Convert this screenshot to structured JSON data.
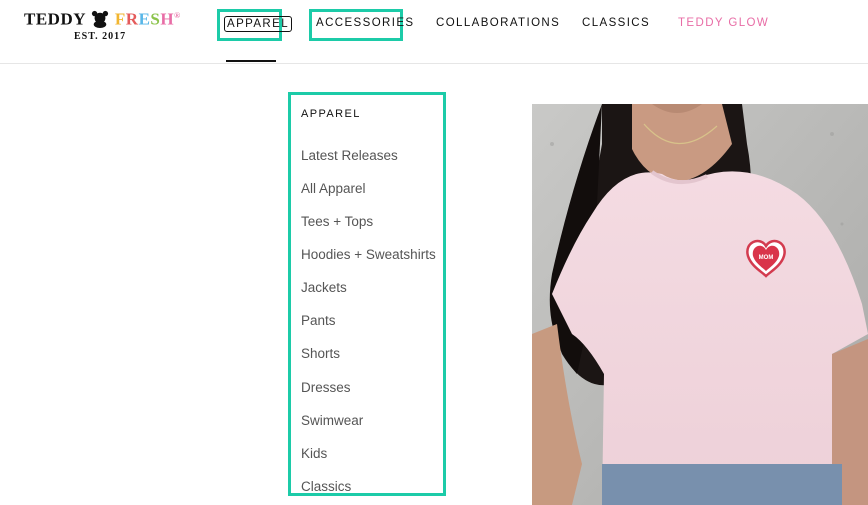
{
  "brand": {
    "name_part1": "TEDDY",
    "name_part2": "FRESH",
    "est": "EST. 2017",
    "reg_mark": "®",
    "bear_icon": "teddy-bear-icon",
    "fresh_colors": [
      "#f2b630",
      "#e45b5b",
      "#59b7e8",
      "#8bc34a",
      "#e86da6"
    ]
  },
  "nav": {
    "items": [
      {
        "label": "APPAREL"
      },
      {
        "label": "ACCESSORIES"
      },
      {
        "label": "COLLABORATIONS"
      },
      {
        "label": "CLASSICS"
      },
      {
        "label": "TEDDY GLOW"
      }
    ],
    "active": "APPAREL",
    "glow_color": "#e86da6",
    "highlight_color": "#1ccba8"
  },
  "dropdown": {
    "title": "APPAREL",
    "items": [
      {
        "label": "Latest Releases"
      },
      {
        "label": "All Apparel"
      },
      {
        "label": "Tees + Tops"
      },
      {
        "label": "Hoodies + Sweatshirts"
      },
      {
        "label": "Jackets"
      },
      {
        "label": "Pants"
      },
      {
        "label": "Shorts"
      },
      {
        "label": "Dresses"
      },
      {
        "label": "Swimwear"
      },
      {
        "label": "Kids"
      },
      {
        "label": "Classics"
      }
    ]
  },
  "feature_image": {
    "patch_text": "MOM"
  }
}
